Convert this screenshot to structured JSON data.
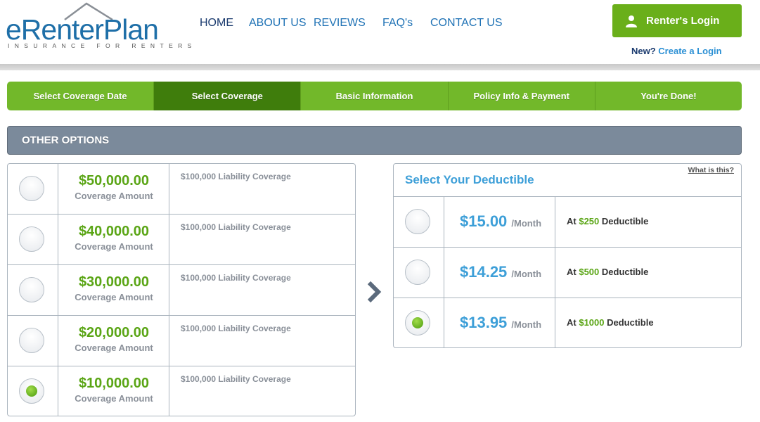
{
  "brand": {
    "logo_text": "eRenterPlan",
    "tagline": "INSURANCE FOR RENTERS"
  },
  "nav": {
    "items": [
      {
        "label": "HOME",
        "active": true
      },
      {
        "label": "ABOUT US",
        "active": false
      },
      {
        "label": "REVIEWS",
        "active": false
      },
      {
        "label": "FAQ's",
        "active": false
      },
      {
        "label": "CONTACT US",
        "active": false
      }
    ]
  },
  "login": {
    "button_label": "Renter's Login",
    "new_prefix": "New?",
    "create_label": "Create a Login"
  },
  "steps": [
    {
      "label": "Select Coverage Date",
      "active": false
    },
    {
      "label": "Select Coverage",
      "active": true
    },
    {
      "label": "Basic Information",
      "active": false
    },
    {
      "label": "Policy Info & Payment",
      "active": false
    },
    {
      "label": "You're Done!",
      "active": false
    }
  ],
  "options_title": "OTHER OPTIONS",
  "coverage": {
    "amount_label": "Coverage Amount",
    "rows": [
      {
        "amount": "$50,000.00",
        "liability": "$100,000 Liability Coverage",
        "selected": false
      },
      {
        "amount": "$40,000.00",
        "liability": "$100,000 Liability Coverage",
        "selected": false
      },
      {
        "amount": "$30,000.00",
        "liability": "$100,000 Liability Coverage",
        "selected": false
      },
      {
        "amount": "$20,000.00",
        "liability": "$100,000 Liability Coverage",
        "selected": false
      },
      {
        "amount": "$10,000.00",
        "liability": "$100,000 Liability Coverage",
        "selected": true
      }
    ]
  },
  "deductible": {
    "title": "Select Your Deductible",
    "what_link": "What is this?",
    "per_label": "/Month",
    "at_prefix": "At",
    "suffix": "Deductible",
    "rows": [
      {
        "price": "$15.00",
        "deductible": "$250",
        "selected": false
      },
      {
        "price": "$14.25",
        "deductible": "$500",
        "selected": false
      },
      {
        "price": "$13.95",
        "deductible": "$1000",
        "selected": true
      }
    ]
  },
  "colors": {
    "brand_blue": "#1e6fa8",
    "green": "#6aaf1a",
    "dark_green": "#3f7d0c",
    "price_blue": "#3d9fd8",
    "gray_bar": "#7b8a9b"
  }
}
